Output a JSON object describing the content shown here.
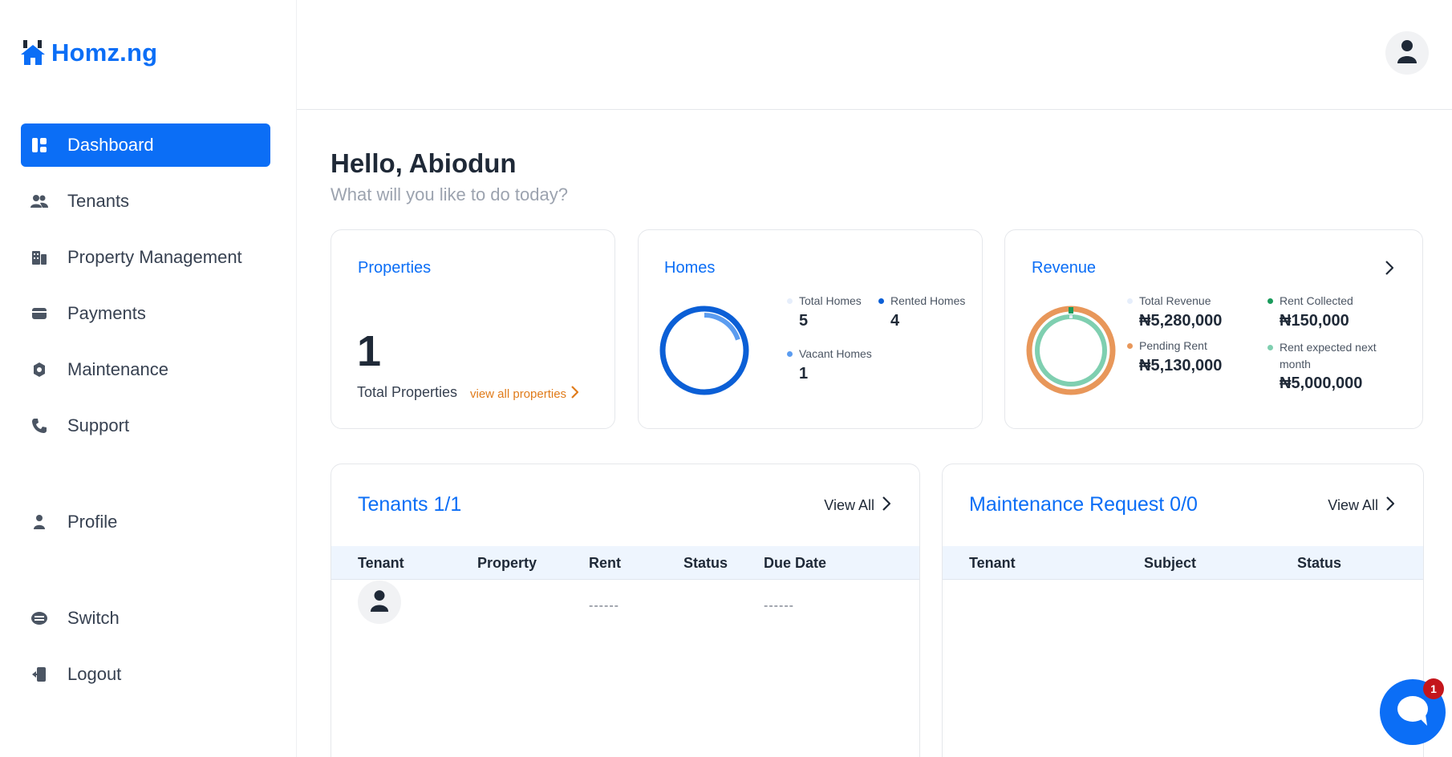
{
  "brand": {
    "name": "Homz.ng",
    "color": "#0b6ef6"
  },
  "sidebar": {
    "items": [
      {
        "label": "Dashboard",
        "icon": "dashboard-icon",
        "active": true
      },
      {
        "label": "Tenants",
        "icon": "users-icon"
      },
      {
        "label": "Property Management",
        "icon": "building-icon"
      },
      {
        "label": "Payments",
        "icon": "wallet-icon"
      },
      {
        "label": "Maintenance",
        "icon": "gear-icon"
      },
      {
        "label": "Support",
        "icon": "phone-icon"
      },
      {
        "label": "Profile",
        "icon": "user-icon"
      },
      {
        "label": "Switch",
        "icon": "switch-icon"
      },
      {
        "label": "Logout",
        "icon": "logout-icon"
      }
    ]
  },
  "header": {
    "avatar_icon": "user-avatar-icon"
  },
  "greeting": {
    "title": "Hello, Abiodun",
    "subtitle": "What will you like to do today?"
  },
  "properties_card": {
    "title": "Properties",
    "count": "1",
    "label": "Total Properties",
    "link": "view all properties"
  },
  "homes_card": {
    "title": "Homes",
    "total_label": "Total Homes",
    "total_value": "5",
    "rented_label": "Rented Homes",
    "rented_value": "4",
    "vacant_label": "Vacant Homes",
    "vacant_value": "1",
    "colors": {
      "total": "#e6eefb",
      "rented": "#0b5fd6",
      "vacant": "#5b9cf0"
    }
  },
  "revenue_card": {
    "title": "Revenue",
    "total_label": "Total Revenue",
    "total_value": "₦5,280,000",
    "collected_label": "Rent Collected",
    "collected_value": "₦150,000",
    "pending_label": "Pending Rent",
    "pending_value": "₦5,130,000",
    "expected_label": "Rent expected next month",
    "expected_value": "₦5,000,000",
    "colors": {
      "total": "#e6eefb",
      "collected": "#1a9b5c",
      "pending": "#e8975a",
      "expected": "#7fcfb0"
    }
  },
  "tenants_table": {
    "title": "Tenants 1/1",
    "view_all": "View All",
    "columns": [
      "Tenant",
      "Property",
      "Rent",
      "Status",
      "Due Date"
    ],
    "rows": [
      {
        "rent": "------",
        "due": "------"
      }
    ]
  },
  "maintenance_table": {
    "title": "Maintenance Request 0/0",
    "view_all": "View All",
    "columns": [
      "Tenant",
      "Subject",
      "Status"
    ]
  },
  "chat": {
    "badge": "1"
  }
}
